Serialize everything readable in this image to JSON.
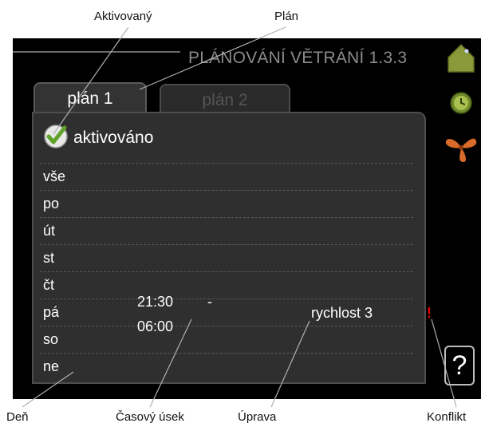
{
  "callouts": {
    "activated": "Aktivovaný",
    "schedule": "Plán",
    "day": "Deň",
    "time_period": "Časový úsek",
    "adjustment": "Úprava",
    "conflict": "Konflikt"
  },
  "screen": {
    "title": "PLÁNOVÁNÍ VĚTRÁNÍ 1.3.3",
    "tabs": [
      {
        "label": "plán 1",
        "active": true
      },
      {
        "label": "plán 2",
        "active": false
      }
    ],
    "activated_label": "aktivováno",
    "days": [
      "vše",
      "po",
      "út",
      "st",
      "čt",
      "pá",
      "so",
      "ne"
    ],
    "schedule_entry": {
      "start": "21:30",
      "dash": "-",
      "end": "06:00",
      "setting": "rychlost 3",
      "conflict_mark": "!"
    },
    "help_label": "?"
  },
  "icons": [
    "house-icon",
    "clock-icon",
    "fan-icon",
    "checkmark-icon",
    "help-icon"
  ],
  "colors": {
    "screen_bg": "#000000",
    "panel_bg": "#2f2f2f",
    "check_green": "#5fa32a",
    "conflict_red": "#e00000",
    "house_green": "#8a9a3a",
    "fan_orange": "#d86a2a"
  }
}
